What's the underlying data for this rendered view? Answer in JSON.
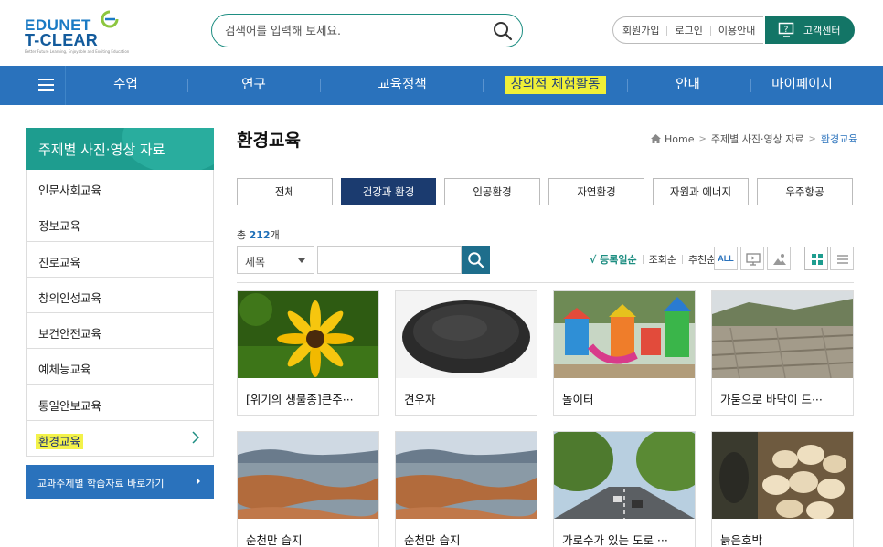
{
  "logo": {
    "line1": "EDUNET",
    "line2": "T-CLEAR",
    "tagline": "Better Future Learning, Enjoyable and Exciting Education"
  },
  "search": {
    "placeholder": "검색어를 입력해 보세요."
  },
  "util": {
    "join": "회원가입",
    "login": "로그인",
    "guide": "이용안내",
    "cs": "고객센터"
  },
  "nav": {
    "items": [
      "수업",
      "연구",
      "교육정책",
      "창의적 체험활동",
      "안내",
      "마이페이지"
    ],
    "highlight_index": 3
  },
  "sidebar": {
    "title": "주제별 사진·영상 자료",
    "items": [
      "인문사회교육",
      "정보교육",
      "진로교육",
      "창의인성교육",
      "보건안전교육",
      "예체능교육",
      "통일안보교육",
      "환경교육"
    ],
    "active_index": 7,
    "link": "교과주제별 학습자료 바로가기"
  },
  "main": {
    "title": "환경교육",
    "breadcrumb": [
      "Home",
      "주제별 사진·영상 자료",
      "환경교육"
    ],
    "tabs": [
      "전체",
      "건강과 환경",
      "인공환경",
      "자연환경",
      "자원과 에너지",
      "우주항공"
    ],
    "active_tab": 1,
    "total_prefix": "총",
    "total_count": "212",
    "total_suffix": "개",
    "select_label": "제목",
    "sort": [
      "√ 등록일순",
      "조회순",
      "추천순"
    ],
    "view_all_label": "ALL",
    "cards": [
      {
        "caption": "[위기의 생물종]큰주···",
        "thumb": "yellow-flower"
      },
      {
        "caption": "견우자",
        "thumb": "black-seeds"
      },
      {
        "caption": "놀이터",
        "thumb": "playground"
      },
      {
        "caption": "가뭄으로 바닥이 드···",
        "thumb": "dry-riverbed"
      },
      {
        "caption": "순천만 습지",
        "thumb": "wetland"
      },
      {
        "caption": "순천만 습지",
        "thumb": "wetland"
      },
      {
        "caption": "가로수가 있는 도로 ···",
        "thumb": "tree-road"
      },
      {
        "caption": "늙은호박",
        "thumb": "pumpkins"
      }
    ]
  },
  "colors": {
    "nav": "#2a72bc",
    "sidebar_title": "#1e9d8f",
    "active_tab": "#1b3b6f",
    "cs_button": "#137566",
    "highlight": "#f0ef37"
  }
}
